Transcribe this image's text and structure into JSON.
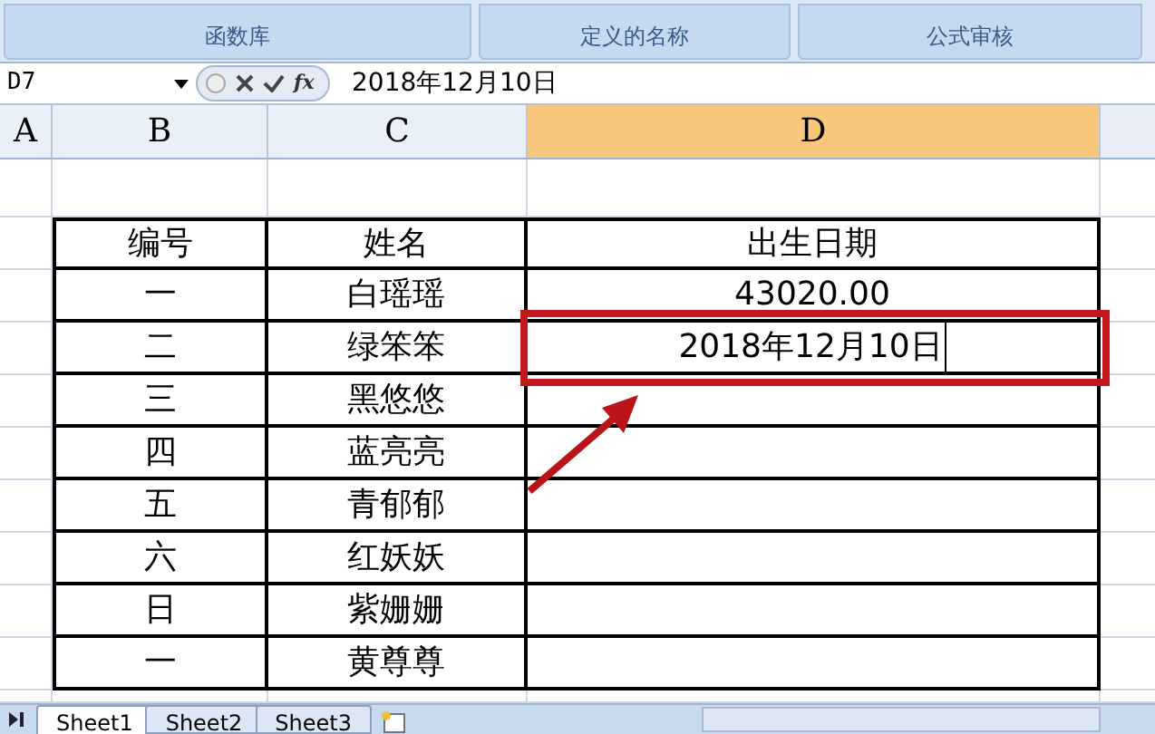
{
  "ribbon": {
    "groups": [
      "函数库",
      "定义的名称",
      "公式审核"
    ]
  },
  "formula_bar": {
    "name_box": "D7",
    "function_button": "fx",
    "value": "2018年12月10日"
  },
  "columns": [
    {
      "label": "A",
      "selected": false
    },
    {
      "label": "B",
      "selected": false
    },
    {
      "label": "C",
      "selected": false
    },
    {
      "label": "D",
      "selected": true
    }
  ],
  "table": {
    "columns": [
      "编号",
      "姓名",
      "出生日期"
    ],
    "rows": [
      {
        "cells": [
          "一",
          "白瑶瑶",
          "43020.00"
        ],
        "editing": false
      },
      {
        "cells": [
          "二",
          "绿笨笨",
          "2018年12月10日"
        ],
        "editing": true
      },
      {
        "cells": [
          "三",
          "黑悠悠",
          ""
        ],
        "editing": false
      },
      {
        "cells": [
          "四",
          "蓝亮亮",
          ""
        ],
        "editing": false
      },
      {
        "cells": [
          "五",
          "青郁郁",
          ""
        ],
        "editing": false
      },
      {
        "cells": [
          "六",
          "红妖妖",
          ""
        ],
        "editing": false
      },
      {
        "cells": [
          "日",
          "紫姗姗",
          ""
        ],
        "editing": false
      },
      {
        "cells": [
          "一",
          "黄尊尊",
          ""
        ],
        "editing": false
      }
    ]
  },
  "sheet_tabs": [
    {
      "label": "Sheet1",
      "selected": true
    },
    {
      "label": "Sheet2",
      "selected": false
    },
    {
      "label": "Sheet3",
      "selected": false
    }
  ]
}
